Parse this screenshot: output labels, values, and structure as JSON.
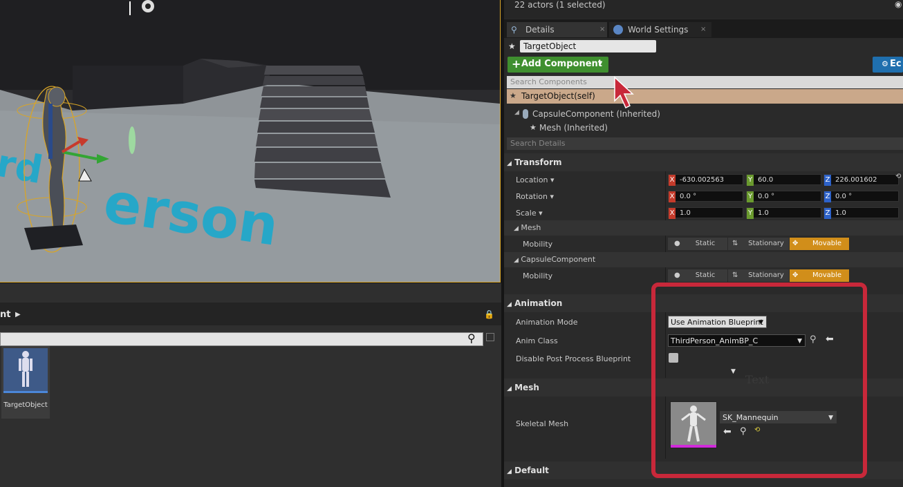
{
  "outliner": {
    "status": "22 actors (1 selected)"
  },
  "tabs": {
    "details": "Details",
    "world_settings": "World Settings"
  },
  "actor": {
    "name": "TargetObject"
  },
  "toolbar": {
    "add_component": "Add Component",
    "edit_partial": "Ec"
  },
  "components": {
    "search_placeholder": "Search Components",
    "items": [
      "TargetObject(self)",
      "CapsuleComponent (Inherited)",
      "Mesh (Inherited)"
    ]
  },
  "details": {
    "search_placeholder": "Search Details"
  },
  "transform": {
    "title": "Transform",
    "location_label": "Location",
    "rotation_label": "Rotation",
    "scale_label": "Scale",
    "location": {
      "x": "-630.002563",
      "y": "60.0",
      "z": "226.001602"
    },
    "rotation": {
      "x": "0.0 °",
      "y": "0.0 °",
      "z": "0.0 °"
    },
    "scale": {
      "x": "1.0",
      "y": "1.0",
      "z": "1.0"
    },
    "axis": {
      "x": "X",
      "y": "Y",
      "z": "Z"
    },
    "axis_colors": {
      "x": "#c43b2b",
      "y": "#6a9a2e",
      "z": "#2d62c9"
    }
  },
  "mobility": {
    "mesh_group": "Mesh",
    "capsule_group": "CapsuleComponent",
    "label": "Mobility",
    "static": "Static",
    "stationary": "Stationary",
    "movable": "Movable"
  },
  "animation": {
    "title": "Animation",
    "mode_label": "Animation Mode",
    "mode_value": "Use Animation Blueprint",
    "class_label": "Anim Class",
    "class_value": "ThirdPerson_AnimBP_C",
    "disable_pp_label": "Disable Post Process Blueprint"
  },
  "mesh_section": {
    "title": "Mesh",
    "skeletal_label": "Skeletal Mesh",
    "skeletal_value": "SK_Mannequin"
  },
  "default_section": {
    "title": "Default"
  },
  "content_browser": {
    "header": "nt",
    "asset_name": "TargetObject"
  },
  "viewport": {
    "floor_text": "erson",
    "floor_text_left": "rd"
  },
  "overlay": {
    "ghost_text": "Text",
    "highlight_color": "#c8283a"
  },
  "colors": {
    "accent_green": "#3f8f2f",
    "movable": "#d18e1a",
    "selection": "#d9a526",
    "component_self": "#caa88a"
  }
}
